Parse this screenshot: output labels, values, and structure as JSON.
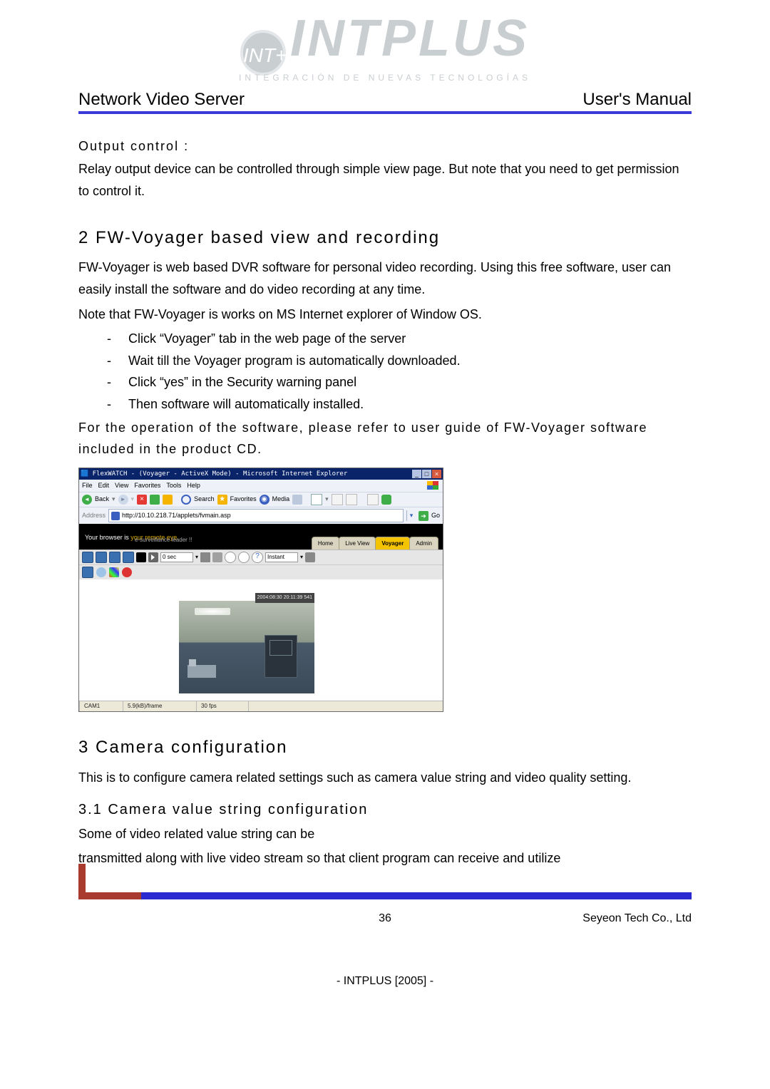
{
  "logo": {
    "badge": "INT+",
    "main": "INTPLUS",
    "sub": "INTEGRACIÓN DE NUEVAS TECNOLOGÍAS"
  },
  "header": {
    "left": "Network Video Server",
    "right": "User's Manual"
  },
  "sections": {
    "output_control": {
      "title": "Output control :",
      "body": "Relay output device can be controlled through simple view page. But note that you need to get permission to control it."
    },
    "voyager": {
      "title": "2 FW-Voyager based view and recording",
      "p1": "FW-Voyager is web based DVR software for personal video recording. Using this free software, user can easily install the software and do video recording at any time.",
      "p2": "Note that FW-Voyager is works on MS Internet explorer of Window OS.",
      "bullets": [
        "Click “Voyager” tab in the web page of the server",
        "Wait till the Voyager program is automatically downloaded.",
        "Click “yes” in the Security warning panel",
        "Then software will automatically installed."
      ],
      "note": "For the operation of the software, please refer to user guide of FW-Voyager software included in the product CD."
    },
    "camera_config": {
      "title": "3 Camera configuration",
      "intro": "This is to configure camera related settings such as camera value string and video quality setting.",
      "sub1_title": "3.1 Camera value string configuration",
      "sub1_p1": "Some of video related value string can be",
      "sub1_p2": "transmitted along with live video stream so that client program can receive and utilize"
    }
  },
  "screenshot": {
    "window_title": "FlexWATCH - (Voyager - ActiveX Mode) - Microsoft Internet Explorer",
    "menu": [
      "File",
      "Edit",
      "View",
      "Favorites",
      "Tools",
      "Help"
    ],
    "toolbar": {
      "back": "Back",
      "search": "Search",
      "favorites": "Favorites",
      "media": "Media"
    },
    "address_label": "Address",
    "address_url": "http://10.10.218.71/applets/fvmain.asp",
    "go": "Go",
    "banner_line1a": "Your browser is ",
    "banner_line1b": "your remote eye.",
    "banner_line2": "e-surveillance leader !!",
    "tabs": [
      "Home",
      "Live View",
      "Voyager",
      "Admin"
    ],
    "toolbar2": {
      "sel1": "0 sec",
      "sel2": "Instant"
    },
    "cam_timestamp": "2004:08:30 20:11:39 541",
    "status": {
      "name": "CAM1",
      "kbf": "5.9(kB)/frame",
      "fps": "30 fps"
    }
  },
  "footer": {
    "page": "36",
    "company": "Seyeon Tech Co., Ltd",
    "brand": "- INTPLUS [2005] -"
  }
}
